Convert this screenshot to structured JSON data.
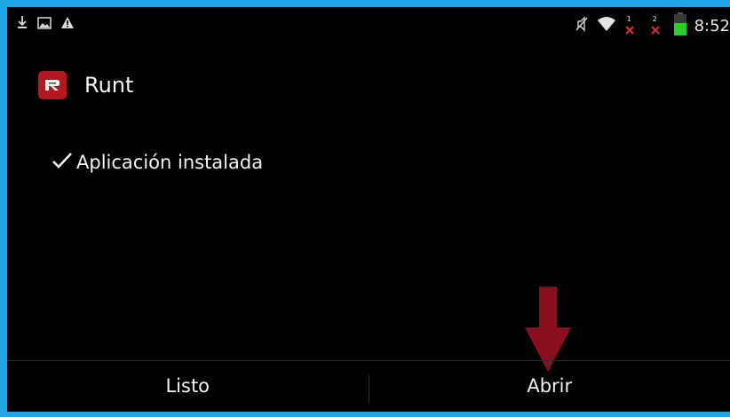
{
  "status_bar": {
    "left_icons": [
      "download-icon",
      "image-icon",
      "warning-icon"
    ],
    "right_icons": [
      "mute-icon",
      "wifi-icon",
      "sim1-no-signal-icon",
      "sim2-no-signal-icon",
      "battery-icon"
    ],
    "sim1_label": "1",
    "sim2_label": "2",
    "time": "8:52"
  },
  "app": {
    "icon_letter": "R",
    "name": "Runt",
    "brand_color": "#b3171f"
  },
  "message": {
    "check_icon": "checkmark-icon",
    "text": "Aplicación instalada"
  },
  "annotation": {
    "arrow_color": "#8a0f1e",
    "arrow_direction": "down"
  },
  "buttons": {
    "done_label": "Listo",
    "open_label": "Abrir"
  },
  "colors": {
    "frame": "#1ea6e8",
    "background": "#000000",
    "battery": "#2ad12a",
    "no_signal_x": "#e0282e"
  }
}
